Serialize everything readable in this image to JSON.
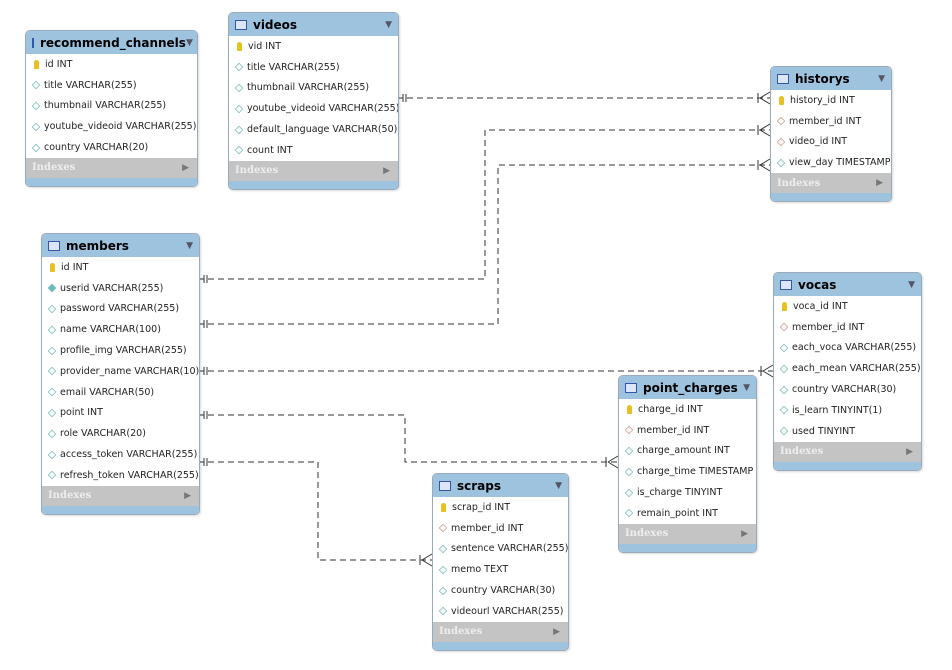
{
  "colors": {
    "header": "#9dc3de",
    "indexes": "#c4c4c4",
    "line": "#333333"
  },
  "indexes_label": "Indexes",
  "tables": [
    {
      "name": "recommend_channels",
      "columns": [
        {
          "t": "pk",
          "label": "id INT"
        },
        {
          "t": "col",
          "label": "title VARCHAR(255)"
        },
        {
          "t": "col",
          "label": "thumbnail VARCHAR(255)"
        },
        {
          "t": "col",
          "label": "youtube_videoid VARCHAR(255)"
        },
        {
          "t": "col",
          "label": "country VARCHAR(20)"
        }
      ]
    },
    {
      "name": "videos",
      "columns": [
        {
          "t": "pk",
          "label": "vid INT"
        },
        {
          "t": "col",
          "label": "title VARCHAR(255)"
        },
        {
          "t": "col",
          "label": "thumbnail VARCHAR(255)"
        },
        {
          "t": "col",
          "label": "youtube_videoid VARCHAR(255)"
        },
        {
          "t": "col",
          "label": "default_language VARCHAR(50)"
        },
        {
          "t": "col",
          "label": "count INT"
        }
      ]
    },
    {
      "name": "historys",
      "columns": [
        {
          "t": "pk",
          "label": "history_id INT"
        },
        {
          "t": "fk",
          "label": "member_id INT"
        },
        {
          "t": "fk",
          "label": "video_id INT"
        },
        {
          "t": "col",
          "label": "view_day TIMESTAMP"
        }
      ]
    },
    {
      "name": "members",
      "columns": [
        {
          "t": "pk",
          "label": "id INT"
        },
        {
          "t": "uq",
          "label": "userid VARCHAR(255)"
        },
        {
          "t": "col",
          "label": "password VARCHAR(255)"
        },
        {
          "t": "col",
          "label": "name VARCHAR(100)"
        },
        {
          "t": "col",
          "label": "profile_img VARCHAR(255)"
        },
        {
          "t": "col",
          "label": "provider_name VARCHAR(10)"
        },
        {
          "t": "col",
          "label": "email VARCHAR(50)"
        },
        {
          "t": "col",
          "label": "point INT"
        },
        {
          "t": "col",
          "label": "role VARCHAR(20)"
        },
        {
          "t": "col",
          "label": "access_token VARCHAR(255)"
        },
        {
          "t": "col",
          "label": "refresh_token VARCHAR(255)"
        }
      ]
    },
    {
      "name": "vocas",
      "columns": [
        {
          "t": "pk",
          "label": "voca_id INT"
        },
        {
          "t": "fk",
          "label": "member_id INT"
        },
        {
          "t": "col",
          "label": "each_voca VARCHAR(255)"
        },
        {
          "t": "col",
          "label": "each_mean VARCHAR(255)"
        },
        {
          "t": "col",
          "label": "country VARCHAR(30)"
        },
        {
          "t": "col",
          "label": "is_learn TINYINT(1)"
        },
        {
          "t": "col",
          "label": "used TINYINT"
        }
      ]
    },
    {
      "name": "point_charges",
      "columns": [
        {
          "t": "pk",
          "label": "charge_id INT"
        },
        {
          "t": "fk",
          "label": "member_id INT"
        },
        {
          "t": "col",
          "label": "charge_amount INT"
        },
        {
          "t": "col",
          "label": "charge_time TIMESTAMP"
        },
        {
          "t": "col",
          "label": "is_charge TINYINT"
        },
        {
          "t": "col",
          "label": "remain_point INT"
        }
      ]
    },
    {
      "name": "scraps",
      "columns": [
        {
          "t": "pk",
          "label": "scrap_id INT"
        },
        {
          "t": "fk",
          "label": "member_id INT"
        },
        {
          "t": "col",
          "label": "sentence VARCHAR(255)"
        },
        {
          "t": "col",
          "label": "memo TEXT"
        },
        {
          "t": "col",
          "label": "country VARCHAR(30)"
        },
        {
          "t": "col",
          "label": "videourl VARCHAR(255)"
        }
      ]
    }
  ],
  "relationships": [
    {
      "from": "videos",
      "to": "historys"
    },
    {
      "from": "members",
      "to": "historys"
    },
    {
      "from": "members",
      "to": "historys"
    },
    {
      "from": "members",
      "to": "vocas"
    },
    {
      "from": "members",
      "to": "point_charges"
    },
    {
      "from": "members",
      "to": "scraps"
    }
  ]
}
